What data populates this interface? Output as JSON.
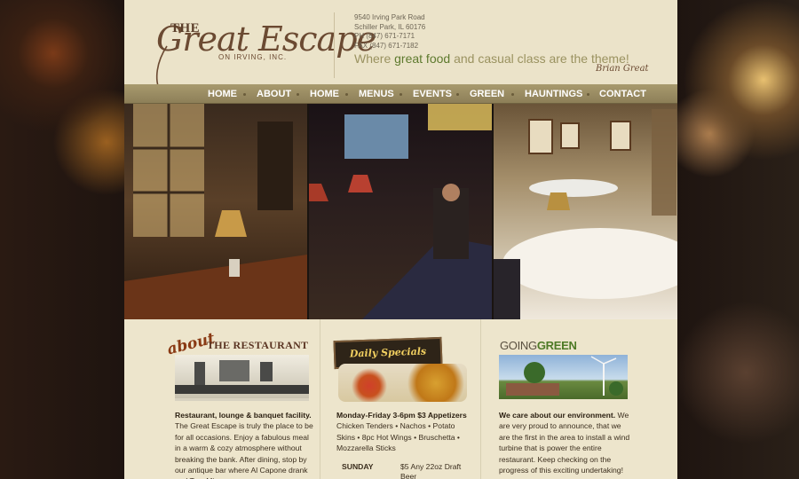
{
  "logo": {
    "the": "THE",
    "main": "Great Escape",
    "sub": "ON IRVING, INC."
  },
  "address": {
    "street": "9540 Irving Park Road",
    "city": "Schiller Park, IL 60176",
    "phone": "PH (847) 671-7171",
    "fax": "FAX (847) 671-7182"
  },
  "tagline": {
    "part1": "Where ",
    "highlight": "great food",
    "part2": " and casual class are the theme!"
  },
  "signature": "Brian Great",
  "nav": [
    "HOME",
    "ABOUT",
    "HOME",
    "MENUS",
    "EVENTS",
    "GREEN",
    "HAUNTINGS",
    "CONTACT"
  ],
  "about": {
    "word": "about",
    "heading": "THE RESTAURANT",
    "lead": "Restaurant, lounge & banquet facility.",
    "text": " The Great Escape is truly the place to be for all occasions. Enjoy a fabulous meal in a warm & cozy atmosphere without breaking the bank. After dining, stop by our antique bar where Al Capone drank and Tom Mix"
  },
  "specials": {
    "sign": "Daily Specials",
    "heading": "Monday-Friday 3-6pm $3 Appetizers",
    "items": "Chicken Tenders • Nachos • Potato Skins • 8pc Hot Wings • Bruschetta • Mozzarella Sticks",
    "day": "SUNDAY",
    "day_special": "$5 Any 22oz Draft Beer"
  },
  "green": {
    "title_part1": "GOING",
    "title_part2": "GREEN",
    "lead": "We care about our environment.",
    "text": " We are very proud to announce, that we are the first in the area to install a wind turbine that is power the entire restaurant. Keep checking on the progress of this exciting undertaking!"
  },
  "colors": {
    "page_bg": "#ede5cc",
    "nav_bg": "#9a8c64",
    "accent_green": "#5e7a2e",
    "brown": "#6b4a32"
  }
}
